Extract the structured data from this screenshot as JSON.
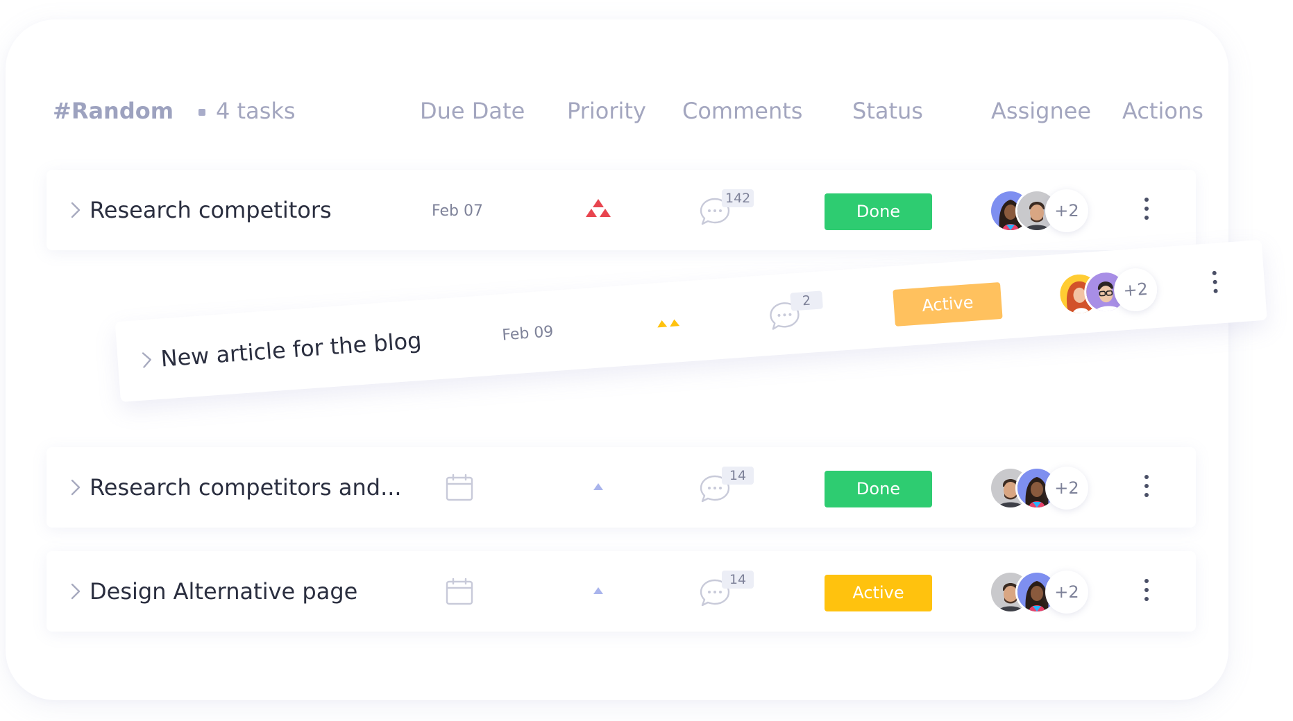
{
  "header": {
    "group": "#Random",
    "task_count": "4 tasks",
    "columns": {
      "due_date": "Due Date",
      "priority": "Priority",
      "comments": "Comments",
      "status": "Status",
      "assignee": "Assignee",
      "actions": "Actions"
    }
  },
  "tasks": [
    {
      "title": "Research competitors",
      "due": "Feb 07",
      "priority": "high",
      "comments": "142",
      "status": "Done",
      "status_color": "#2ecc71",
      "assignees_more": "+2"
    },
    {
      "title": "New article for the blog",
      "due": "Feb 09",
      "priority": "medium",
      "comments": "2",
      "status": "Active",
      "status_color": "#ffc15e",
      "assignees_more": "+2"
    },
    {
      "title": "Research competitors and...",
      "due": "",
      "priority": "low",
      "comments": "14",
      "status": "Done",
      "status_color": "#2ecc71",
      "assignees_more": "+2"
    },
    {
      "title": "Design Alternative page",
      "due": "",
      "priority": "low",
      "comments": "14",
      "status": "Active",
      "status_color": "#ffc20e",
      "assignees_more": "+2"
    }
  ],
  "colors": {
    "priority_high": "#e8454f",
    "priority_medium": "#ffc20e",
    "priority_low": "#a9b4ec",
    "done": "#2ecc71",
    "active": "#ffc20e",
    "active_dragged": "#ffc15e"
  }
}
